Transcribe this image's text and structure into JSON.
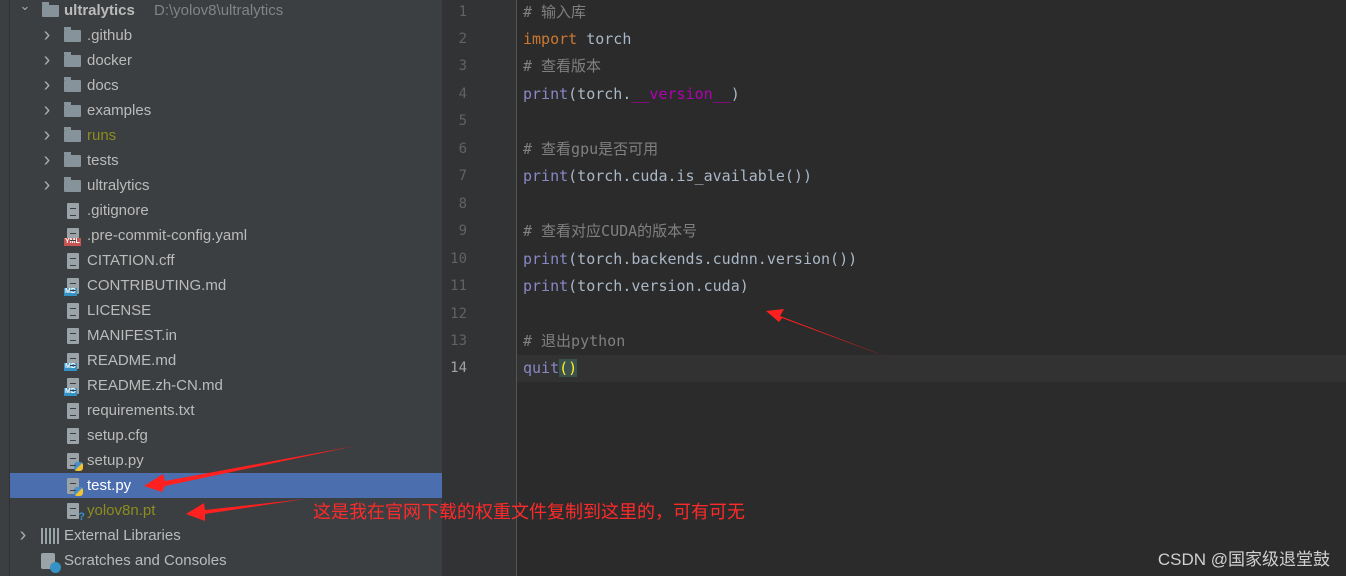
{
  "project_tree": {
    "root": {
      "name": "ultralytics",
      "path": "D:\\yolov8\\ultralytics"
    },
    "items": [
      {
        "label": ".github",
        "type": "folder"
      },
      {
        "label": "docker",
        "type": "folder"
      },
      {
        "label": "docs",
        "type": "folder"
      },
      {
        "label": "examples",
        "type": "folder"
      },
      {
        "label": "runs",
        "type": "folder",
        "status": "ignored"
      },
      {
        "label": "tests",
        "type": "folder"
      },
      {
        "label": "ultralytics",
        "type": "package"
      },
      {
        "label": ".gitignore",
        "type": "file"
      },
      {
        "label": ".pre-commit-config.yaml",
        "type": "yaml",
        "badge": "YML"
      },
      {
        "label": "CITATION.cff",
        "type": "file"
      },
      {
        "label": "CONTRIBUTING.md",
        "type": "md",
        "badge": "MD"
      },
      {
        "label": "LICENSE",
        "type": "file"
      },
      {
        "label": "MANIFEST.in",
        "type": "file"
      },
      {
        "label": "README.md",
        "type": "md",
        "badge": "MD"
      },
      {
        "label": "README.zh-CN.md",
        "type": "md",
        "badge": "MD"
      },
      {
        "label": "requirements.txt",
        "type": "file"
      },
      {
        "label": "setup.cfg",
        "type": "file"
      },
      {
        "label": "setup.py",
        "type": "python"
      },
      {
        "label": "test.py",
        "type": "python",
        "selected": true
      },
      {
        "label": "yolov8n.pt",
        "type": "unknown",
        "status": "ignored"
      }
    ],
    "external_libraries": "External Libraries",
    "scratches": "Scratches and Consoles"
  },
  "editor": {
    "current_line": 14,
    "lines": [
      [
        [
          "cm",
          "# 输入库"
        ]
      ],
      [
        [
          "kw",
          "import"
        ],
        [
          "",
          "torch"
        ]
      ],
      [
        [
          "cm",
          "# 查看版本"
        ]
      ],
      [
        [
          "fn",
          "print"
        ],
        [
          "",
          "(torch."
        ],
        [
          "dn",
          "__version__"
        ],
        [
          "",
          ")"
        ]
      ],
      [],
      [
        [
          "cm",
          "# 查看gpu是否可用"
        ]
      ],
      [
        [
          "fn",
          "print"
        ],
        [
          "",
          "(torch.cuda.is_available())"
        ]
      ],
      [],
      [
        [
          "cm",
          "# 查看对应CUDA的版本号"
        ]
      ],
      [
        [
          "fn",
          "print"
        ],
        [
          "",
          "(torch.backends.cudnn.version())"
        ]
      ],
      [
        [
          "fn",
          "print"
        ],
        [
          "",
          "(torch.version.cuda)"
        ]
      ],
      [],
      [
        [
          "cm",
          "# 退出python"
        ]
      ],
      [
        [
          "fn",
          "quit"
        ],
        [
          "br",
          "()"
        ]
      ]
    ]
  },
  "annotation": "这是我在官网下载的权重文件复制到这里的，可有可无",
  "watermark": "CSDN @国家级退堂鼓",
  "colors": {
    "annotation": "#ff2a2a",
    "selection": "#4b6eaf",
    "ignored": "#8c8c20"
  }
}
